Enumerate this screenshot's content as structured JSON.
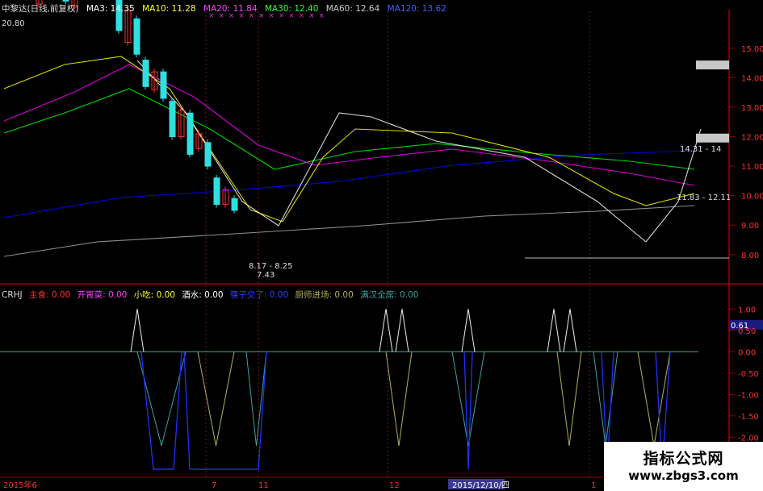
{
  "header": {
    "title": "中黎达(日线,前复权)",
    "ma3": "MA3: 14.35",
    "ma10": "MA10: 11.28",
    "ma20": "MA20: 11.84",
    "ma30": "MA30: 12.40",
    "ma60": "MA60: 12.64",
    "ma120": "MA120: 13.62",
    "marks": "× × × × × × × × × × × ×"
  },
  "indicator_header": {
    "name": "CRHJ",
    "items": [
      {
        "label": "主食: 0.00",
        "color": "#ff3030"
      },
      {
        "label": "开胃菜: 0.00",
        "color": "#ff40ff"
      },
      {
        "label": "小吃: 0.00",
        "color": "#ffff40"
      },
      {
        "label": "酒水: 0.00",
        "color": "#ffffff"
      },
      {
        "label": "筷子交了: 0.00",
        "color": "#3040ff"
      },
      {
        "label": "厨师进场: 0.00",
        "color": "#b0b060"
      },
      {
        "label": "满汉全席: 0.00",
        "color": "#40a0a0"
      }
    ]
  },
  "watermark": {
    "line1": "指标公式网",
    "line2": "www.zbgs3.com"
  },
  "chart_data": [
    {
      "type": "candlestick",
      "title": "中黎达(日线,前复权)",
      "y_ticks": [
        "15.00",
        "14.00",
        "13.00",
        "12.00",
        "11.00",
        "10.00",
        "9.00",
        "8.00"
      ],
      "ylim": [
        7.2,
        16.2
      ],
      "annotations": [
        "20.80",
        "8.17 - 8.25",
        "7.43",
        "14.31 - 14",
        "11.83 - 12.11"
      ],
      "highlight_price_boxes": [
        14.31,
        11.83
      ],
      "x_labels": [
        "2015年6",
        "7",
        "11",
        "12",
        "2015/12/10/四",
        "1"
      ],
      "candles_approx": [
        {
          "o": 18.0,
          "c": 19.5
        },
        {
          "o": 17.2,
          "c": 18.8
        },
        {
          "o": 17.8,
          "c": 17.0
        },
        {
          "o": 16.5,
          "c": 17.5
        },
        {
          "o": 17.2,
          "c": 18.5
        },
        {
          "o": 17.5,
          "c": 17.3
        },
        {
          "o": 17.2,
          "c": 16.6
        },
        {
          "o": 16.4,
          "c": 17.2
        },
        {
          "o": 16.8,
          "c": 17.5
        },
        {
          "o": 17.2,
          "c": 18.9
        },
        {
          "o": 18.6,
          "c": 19.9
        },
        {
          "o": 18.8,
          "c": 17.4
        },
        {
          "o": 17.0,
          "c": 15.6
        },
        {
          "o": 15.2,
          "c": 16.3
        },
        {
          "o": 16.0,
          "c": 14.8
        },
        {
          "o": 14.6,
          "c": 13.7
        },
        {
          "o": 13.6,
          "c": 14.2
        },
        {
          "o": 14.2,
          "c": 13.3
        },
        {
          "o": 13.2,
          "c": 12.0
        },
        {
          "o": 12.0,
          "c": 12.9
        },
        {
          "o": 12.8,
          "c": 11.4
        },
        {
          "o": 11.6,
          "c": 12.1
        },
        {
          "o": 11.8,
          "c": 11.0
        },
        {
          "o": 10.6,
          "c": 9.7
        },
        {
          "o": 9.7,
          "c": 10.2
        },
        {
          "o": 9.9,
          "c": 9.5
        }
      ],
      "moving_averages": [
        {
          "name": "MA3",
          "color": "#ffffff"
        },
        {
          "name": "MA10",
          "color": "#ffff00"
        },
        {
          "name": "MA20",
          "color": "#ff00ff"
        },
        {
          "name": "MA30",
          "color": "#00ff00"
        },
        {
          "name": "MA60",
          "color": "#aaaaaa"
        },
        {
          "name": "MA120",
          "color": "#0000ff"
        }
      ]
    },
    {
      "type": "line",
      "title": "CRHJ",
      "y_ticks": [
        "1.00",
        "0.50",
        "0.00",
        "-0.50",
        "-1.00",
        "-1.50",
        "-2.00",
        "-2.50"
      ],
      "ylim": [
        -2.9,
        1.25
      ],
      "annotations": [
        "0.61"
      ],
      "series": [
        {
          "name": "主食",
          "color": "#ff3030"
        },
        {
          "name": "开胃菜",
          "color": "#ff40ff"
        },
        {
          "name": "小吃",
          "color": "#ffff40"
        },
        {
          "name": "酒水",
          "color": "#ffffff"
        },
        {
          "name": "筷子交了",
          "color": "#3040ff"
        },
        {
          "name": "厨师进场",
          "color": "#b0b060"
        },
        {
          "name": "满汉全席",
          "color": "#40a0a0"
        }
      ]
    }
  ]
}
